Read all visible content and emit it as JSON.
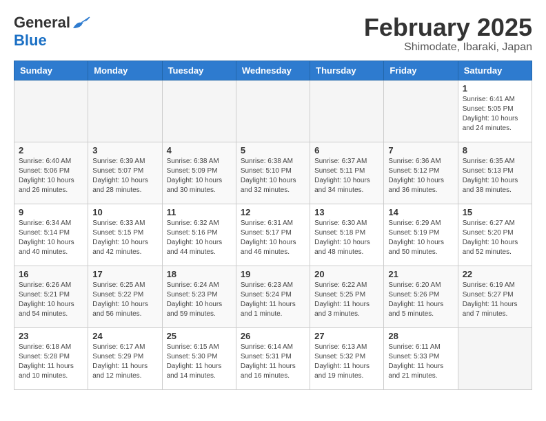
{
  "header": {
    "logo_general": "General",
    "logo_blue": "Blue",
    "month_title": "February 2025",
    "location": "Shimodate, Ibaraki, Japan"
  },
  "weekdays": [
    "Sunday",
    "Monday",
    "Tuesday",
    "Wednesday",
    "Thursday",
    "Friday",
    "Saturday"
  ],
  "weeks": [
    [
      {
        "day": "",
        "info": ""
      },
      {
        "day": "",
        "info": ""
      },
      {
        "day": "",
        "info": ""
      },
      {
        "day": "",
        "info": ""
      },
      {
        "day": "",
        "info": ""
      },
      {
        "day": "",
        "info": ""
      },
      {
        "day": "1",
        "info": "Sunrise: 6:41 AM\nSunset: 5:05 PM\nDaylight: 10 hours and 24 minutes."
      }
    ],
    [
      {
        "day": "2",
        "info": "Sunrise: 6:40 AM\nSunset: 5:06 PM\nDaylight: 10 hours and 26 minutes."
      },
      {
        "day": "3",
        "info": "Sunrise: 6:39 AM\nSunset: 5:07 PM\nDaylight: 10 hours and 28 minutes."
      },
      {
        "day": "4",
        "info": "Sunrise: 6:38 AM\nSunset: 5:09 PM\nDaylight: 10 hours and 30 minutes."
      },
      {
        "day": "5",
        "info": "Sunrise: 6:38 AM\nSunset: 5:10 PM\nDaylight: 10 hours and 32 minutes."
      },
      {
        "day": "6",
        "info": "Sunrise: 6:37 AM\nSunset: 5:11 PM\nDaylight: 10 hours and 34 minutes."
      },
      {
        "day": "7",
        "info": "Sunrise: 6:36 AM\nSunset: 5:12 PM\nDaylight: 10 hours and 36 minutes."
      },
      {
        "day": "8",
        "info": "Sunrise: 6:35 AM\nSunset: 5:13 PM\nDaylight: 10 hours and 38 minutes."
      }
    ],
    [
      {
        "day": "9",
        "info": "Sunrise: 6:34 AM\nSunset: 5:14 PM\nDaylight: 10 hours and 40 minutes."
      },
      {
        "day": "10",
        "info": "Sunrise: 6:33 AM\nSunset: 5:15 PM\nDaylight: 10 hours and 42 minutes."
      },
      {
        "day": "11",
        "info": "Sunrise: 6:32 AM\nSunset: 5:16 PM\nDaylight: 10 hours and 44 minutes."
      },
      {
        "day": "12",
        "info": "Sunrise: 6:31 AM\nSunset: 5:17 PM\nDaylight: 10 hours and 46 minutes."
      },
      {
        "day": "13",
        "info": "Sunrise: 6:30 AM\nSunset: 5:18 PM\nDaylight: 10 hours and 48 minutes."
      },
      {
        "day": "14",
        "info": "Sunrise: 6:29 AM\nSunset: 5:19 PM\nDaylight: 10 hours and 50 minutes."
      },
      {
        "day": "15",
        "info": "Sunrise: 6:27 AM\nSunset: 5:20 PM\nDaylight: 10 hours and 52 minutes."
      }
    ],
    [
      {
        "day": "16",
        "info": "Sunrise: 6:26 AM\nSunset: 5:21 PM\nDaylight: 10 hours and 54 minutes."
      },
      {
        "day": "17",
        "info": "Sunrise: 6:25 AM\nSunset: 5:22 PM\nDaylight: 10 hours and 56 minutes."
      },
      {
        "day": "18",
        "info": "Sunrise: 6:24 AM\nSunset: 5:23 PM\nDaylight: 10 hours and 59 minutes."
      },
      {
        "day": "19",
        "info": "Sunrise: 6:23 AM\nSunset: 5:24 PM\nDaylight: 11 hours and 1 minute."
      },
      {
        "day": "20",
        "info": "Sunrise: 6:22 AM\nSunset: 5:25 PM\nDaylight: 11 hours and 3 minutes."
      },
      {
        "day": "21",
        "info": "Sunrise: 6:20 AM\nSunset: 5:26 PM\nDaylight: 11 hours and 5 minutes."
      },
      {
        "day": "22",
        "info": "Sunrise: 6:19 AM\nSunset: 5:27 PM\nDaylight: 11 hours and 7 minutes."
      }
    ],
    [
      {
        "day": "23",
        "info": "Sunrise: 6:18 AM\nSunset: 5:28 PM\nDaylight: 11 hours and 10 minutes."
      },
      {
        "day": "24",
        "info": "Sunrise: 6:17 AM\nSunset: 5:29 PM\nDaylight: 11 hours and 12 minutes."
      },
      {
        "day": "25",
        "info": "Sunrise: 6:15 AM\nSunset: 5:30 PM\nDaylight: 11 hours and 14 minutes."
      },
      {
        "day": "26",
        "info": "Sunrise: 6:14 AM\nSunset: 5:31 PM\nDaylight: 11 hours and 16 minutes."
      },
      {
        "day": "27",
        "info": "Sunrise: 6:13 AM\nSunset: 5:32 PM\nDaylight: 11 hours and 19 minutes."
      },
      {
        "day": "28",
        "info": "Sunrise: 6:11 AM\nSunset: 5:33 PM\nDaylight: 11 hours and 21 minutes."
      },
      {
        "day": "",
        "info": ""
      }
    ]
  ]
}
